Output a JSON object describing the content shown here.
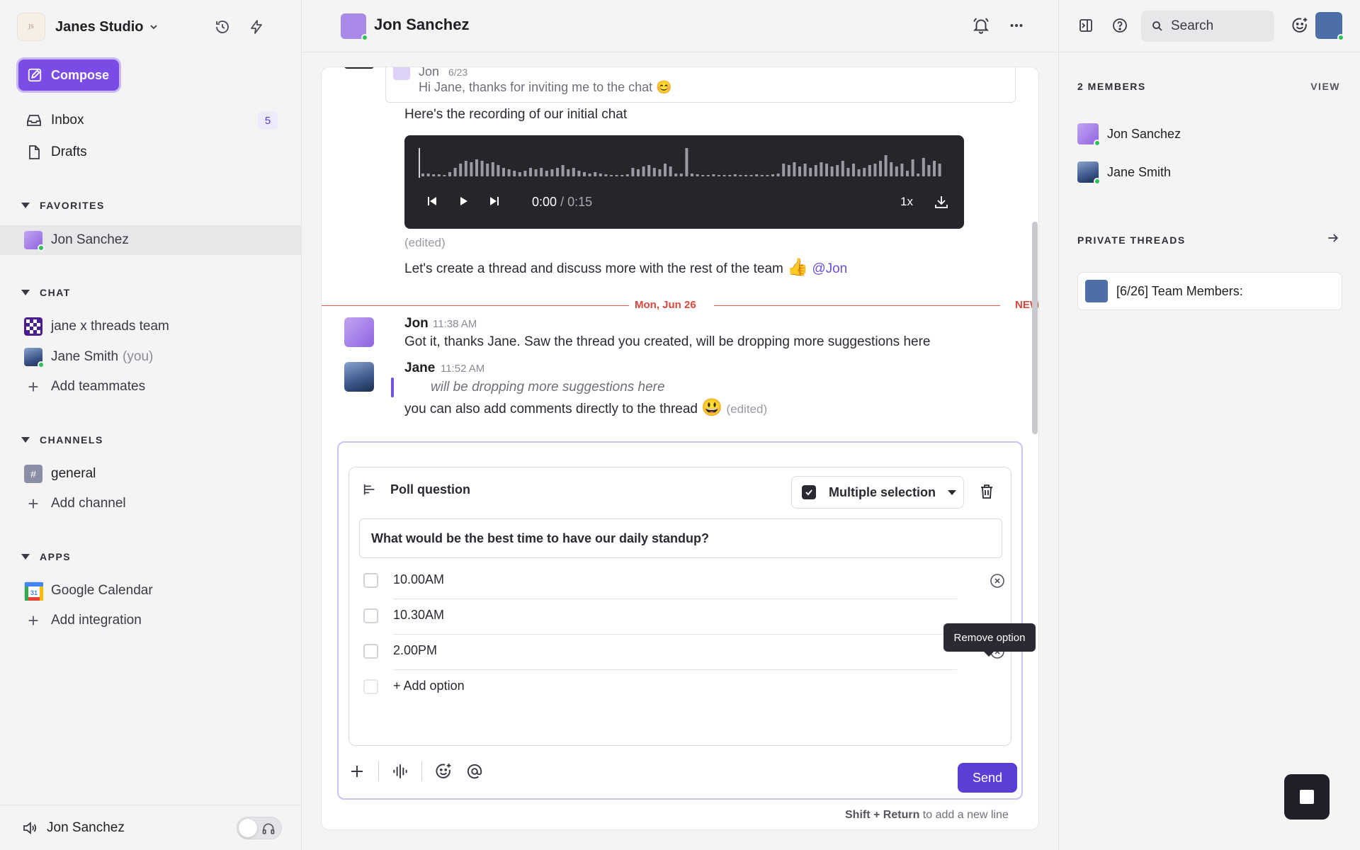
{
  "workspace": {
    "name": "Janes Studio",
    "logo_text": "Janes Studio"
  },
  "sidebar": {
    "compose_label": "Compose",
    "nav": [
      {
        "label": "Inbox",
        "badge": "5",
        "icon": "inbox-icon"
      },
      {
        "label": "Drafts",
        "icon": "file-icon"
      }
    ],
    "favorites": {
      "title": "FAVORITES",
      "items": [
        {
          "label": "Jon Sanchez"
        }
      ]
    },
    "chat": {
      "title": "CHAT",
      "items": [
        {
          "label": "jane x threads team"
        },
        {
          "label": "Jane Smith",
          "suffix": "(you)"
        }
      ],
      "add_label": "Add teammates"
    },
    "channels": {
      "title": "CHANNELS",
      "items": [
        {
          "label": "general"
        }
      ],
      "add_label": "Add channel"
    },
    "apps": {
      "title": "APPS",
      "items": [
        {
          "label": "Google Calendar",
          "icon_text": "31"
        }
      ],
      "add_label": "Add integration"
    },
    "bottom": {
      "name": "Jon Sanchez"
    }
  },
  "header": {
    "title": "Jon Sanchez"
  },
  "thread": {
    "quote": {
      "name": "Jon",
      "date": "6/23",
      "text": "Hi Jane, thanks for inviting me to the chat 😊"
    },
    "recording_text": "Here's the recording of our initial chat",
    "audio": {
      "current": "0:00",
      "duration": "/ 0:15",
      "speed": "1x"
    },
    "edited_label": "(edited)",
    "followup_text": "Let's create a thread and discuss more with the rest of the team",
    "followup_emoji": "👍",
    "mention": "@Jon",
    "divider_date": "Mon, Jun 26",
    "new_label": "NEW",
    "messages": [
      {
        "name": "Jon",
        "time": "11:38 AM",
        "text": "Got it, thanks Jane. Saw the thread you created, will be dropping more suggestions here"
      },
      {
        "name": "Jane",
        "time": "11:52 AM",
        "quote": "will be dropping more suggestions here",
        "text": "you can also add comments directly to the thread",
        "emoji": "😃",
        "edited": "(edited)"
      }
    ]
  },
  "poll": {
    "header_label": "Poll question",
    "mode_label": "Multiple selection",
    "question": "What would be the best time to have our daily standup?",
    "options": [
      "10.00AM",
      "10.30AM",
      "2.00PM"
    ],
    "add_option_label": "+ Add option",
    "tooltip": "Remove option"
  },
  "composer": {
    "send_label": "Send",
    "hint_keys": "Shift + Return",
    "hint_text": "to add a new line"
  },
  "right_panel": {
    "search_label": "Search",
    "members_title": "2 MEMBERS",
    "members_link": "VIEW",
    "members": [
      {
        "name": "Jon Sanchez"
      },
      {
        "name": "Jane Smith"
      }
    ],
    "threads_title": "PRIVATE THREADS",
    "threads": [
      {
        "title": "[6/26] Team Members:"
      }
    ]
  },
  "colors": {
    "accent": "#7b4be6",
    "send": "#5a3ed6",
    "new_divider": "#e2574c",
    "online": "#2fbf5a"
  }
}
